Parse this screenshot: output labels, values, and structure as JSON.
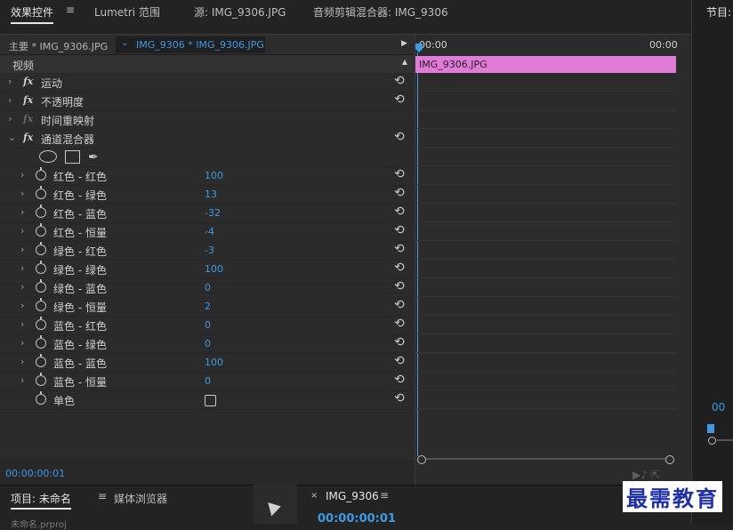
{
  "top_tabs": {
    "effect_controls": "效果控件",
    "lumetri": "Lumetri 范围",
    "source": "源: IMG_9306.JPG",
    "audio_mixer": "音频剪辑混合器: IMG_9306",
    "menu_icon": "≡"
  },
  "effects": {
    "clip_master": "主要 * IMG_9306.JPG",
    "clip_sequence": "IMG_9306 * IMG_9306.JPG",
    "video_header": "视频",
    "rows": [
      {
        "name": "运动",
        "type": "fx"
      },
      {
        "name": "不透明度",
        "type": "fx"
      },
      {
        "name": "时间重映射",
        "type": "fx-dim"
      },
      {
        "name": "通道混合器",
        "type": "fx-open"
      }
    ],
    "params": [
      {
        "name": "红色 - 红色",
        "value": "100"
      },
      {
        "name": "红色 - 绿色",
        "value": "13"
      },
      {
        "name": "红色 - 蓝色",
        "value": "-32"
      },
      {
        "name": "红色 - 恒量",
        "value": "-4"
      },
      {
        "name": "绿色 - 红色",
        "value": "-3"
      },
      {
        "name": "绿色 - 绿色",
        "value": "100"
      },
      {
        "name": "绿色 - 蓝色",
        "value": "0"
      },
      {
        "name": "绿色 - 恒量",
        "value": "2"
      },
      {
        "name": "蓝色 - 红色",
        "value": "0"
      },
      {
        "name": "蓝色 - 绿色",
        "value": "0"
      },
      {
        "name": "蓝色 - 蓝色",
        "value": "100"
      },
      {
        "name": "蓝色 - 恒量",
        "value": "0"
      }
    ],
    "monochrome_label": "单色",
    "monochrome_checked": false,
    "timecode": "00:00:00:01"
  },
  "mini_timeline": {
    "start": "00:00",
    "end": "00:00",
    "clip_label": "IMG_9306.JPG",
    "clip_color": "#e07bd8"
  },
  "program": {
    "title": "节目:",
    "timecode": "00"
  },
  "bottom": {
    "project_tab": "项目: 未命名",
    "media_browser_tab": "媒体浏览器",
    "sequence_tab": "IMG_9306",
    "sequence_timecode": "00:00:00:01",
    "project_item": "未命名.prproj"
  },
  "watermark": "最需教育",
  "colors": {
    "accent": "#3e9ae4",
    "clip": "#e07bd8"
  }
}
